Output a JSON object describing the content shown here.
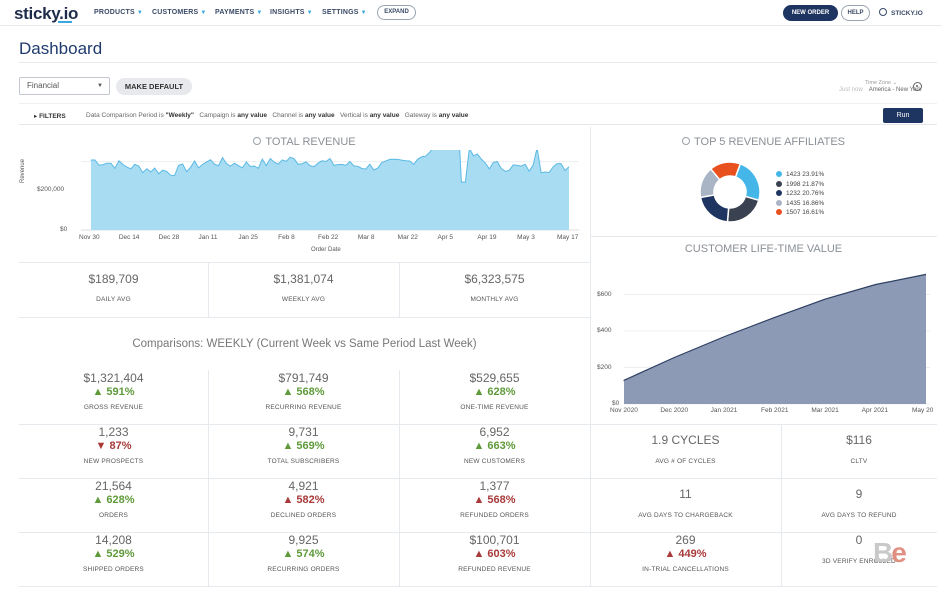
{
  "nav": {
    "logo": "sticky.io",
    "items": [
      {
        "label": "PRODUCTS"
      },
      {
        "label": "CUSTOMERS"
      },
      {
        "label": "PAYMENTS"
      },
      {
        "label": "INSIGHTS"
      },
      {
        "label": "SETTINGS"
      }
    ],
    "expand_label": "EXPAND",
    "new_order_label": "NEW ORDER",
    "help_label": "HELP",
    "user_label": "STICKY.IO"
  },
  "page": {
    "title": "Dashboard",
    "dashboard_select": "Financial",
    "make_default_label": "MAKE DEFAULT",
    "timezone_label": "Time Zone",
    "timezone_updated": "Just now",
    "timezone_value": "America - New York"
  },
  "filters": {
    "toggle_label": "FILTERS",
    "period_label": "Data Comparison Period",
    "period_value": "\"Weekly\"",
    "campaign_label": "Campaign",
    "campaign_value": "any value",
    "channel_label": "Channel",
    "channel_value": "any value",
    "vertical_label": "Vertical",
    "vertical_value": "any value",
    "gateway_label": "Gateway",
    "gateway_value": "any value",
    "is_word": "is",
    "run_label": "Run"
  },
  "revenue": {
    "title": "TOTAL REVENUE",
    "ylabel": "Revenue",
    "xlabel": "Order Date",
    "yticks": [
      "$200,000",
      "$0"
    ],
    "xticks": [
      "Nov 30",
      "Dec 14",
      "Dec 28",
      "Jan 11",
      "Jan 25",
      "Feb 8",
      "Feb 22",
      "Mar 8",
      "Mar 22",
      "Apr 5",
      "Apr 19",
      "May 3",
      "May 17"
    ]
  },
  "affiliates": {
    "title": "TOP 5 REVENUE AFFILIATES",
    "colors": [
      "#45b6e8",
      "#3a4150",
      "#1e3562",
      "#a9b4c5",
      "#e8501e"
    ],
    "legend": [
      "1423 23.91%",
      "1998 21.87%",
      "1232 20.76%",
      "1435 16.86%",
      "1507 16.61%"
    ]
  },
  "clv": {
    "title": "CUSTOMER LIFE-TIME VALUE",
    "yticks": [
      "$600",
      "$400",
      "$200",
      "$0"
    ],
    "xticks": [
      "Nov 2020",
      "Dec 2020",
      "Jan 2021",
      "Feb 2021",
      "Mar 2021",
      "Apr 2021",
      "May 20"
    ]
  },
  "averages": [
    {
      "value": "$189,709",
      "label": "DAILY AVG"
    },
    {
      "value": "$1,381,074",
      "label": "WEEKLY AVG"
    },
    {
      "value": "$6,323,575",
      "label": "MONTHLY AVG"
    }
  ],
  "comparisons": {
    "title": "Comparisons: WEEKLY (Current Week vs Same Period Last Week)",
    "cells": [
      {
        "value": "$1,321,404",
        "delta": "▲ 591%",
        "dir": "up",
        "label": "GROSS REVENUE"
      },
      {
        "value": "$791,749",
        "delta": "▲ 568%",
        "dir": "up",
        "label": "RECURRING REVENUE"
      },
      {
        "value": "$529,655",
        "delta": "▲ 628%",
        "dir": "up",
        "label": "ONE-TIME REVENUE"
      },
      {
        "value": "1,233",
        "delta": "▼ 87%",
        "dir": "down",
        "label": "NEW PROSPECTS"
      },
      {
        "value": "9,731",
        "delta": "▲ 569%",
        "dir": "up",
        "label": "TOTAL SUBSCRIBERS"
      },
      {
        "value": "6,952",
        "delta": "▲ 663%",
        "dir": "up",
        "label": "NEW CUSTOMERS"
      },
      {
        "value": "21,564",
        "delta": "▲ 628%",
        "dir": "up",
        "label": "ORDERS"
      },
      {
        "value": "4,921",
        "delta": "▲ 582%",
        "dir": "down",
        "label": "DECLINED ORDERS"
      },
      {
        "value": "1,377",
        "delta": "▲ 568%",
        "dir": "down",
        "label": "REFUNDED ORDERS"
      },
      {
        "value": "14,208",
        "delta": "▲ 529%",
        "dir": "up",
        "label": "SHIPPED ORDERS"
      },
      {
        "value": "9,925",
        "delta": "▲ 574%",
        "dir": "up",
        "label": "RECURRING ORDERS"
      },
      {
        "value": "$100,701",
        "delta": "▲ 603%",
        "dir": "down",
        "label": "REFUNDED REVENUE"
      }
    ]
  },
  "right_stats": [
    {
      "value": "1.9 CYCLES",
      "delta": "",
      "dir": "",
      "label": "AVG # OF CYCLES"
    },
    {
      "value": "$116",
      "delta": "",
      "dir": "",
      "label": "CLTV"
    },
    {
      "value": "11",
      "delta": "",
      "dir": "",
      "label": "AVG DAYS TO CHARGEBACK"
    },
    {
      "value": "9",
      "delta": "",
      "dir": "",
      "label": "AVG DAYS TO REFUND"
    },
    {
      "value": "269",
      "delta": "▲ 449%",
      "dir": "down",
      "label": "IN-TRIAL CANCELLATIONS"
    },
    {
      "value": "0",
      "delta": "",
      "dir": "",
      "label": "3D VERIFY ENROLLED"
    }
  ],
  "chart_data": [
    {
      "type": "area",
      "title": "TOTAL REVENUE",
      "xlabel": "Order Date",
      "ylabel": "Revenue",
      "ylim": [
        0,
        400000
      ],
      "categories": [
        "Nov 30",
        "Dec 14",
        "Dec 28",
        "Jan 11",
        "Jan 25",
        "Feb 8",
        "Feb 22",
        "Mar 8",
        "Mar 22",
        "Apr 5",
        "Apr 19",
        "May 3",
        "May 17"
      ],
      "values": [
        205000,
        185000,
        170000,
        200000,
        190000,
        205000,
        195000,
        185000,
        200000,
        260000,
        190000,
        180000,
        185000
      ],
      "grid": true
    },
    {
      "type": "pie",
      "title": "TOP 5 REVENUE AFFILIATES",
      "categories": [
        "1423",
        "1998",
        "1232",
        "1435",
        "1507"
      ],
      "values": [
        23.91,
        21.87,
        20.76,
        16.86,
        16.61
      ],
      "legend": "right"
    },
    {
      "type": "area",
      "title": "CUSTOMER LIFE-TIME VALUE",
      "categories": [
        "Nov 2020",
        "Dec 2020",
        "Jan 2021",
        "Feb 2021",
        "Mar 2021",
        "Apr 2021",
        "May 20"
      ],
      "values": [
        130,
        255,
        370,
        475,
        575,
        655,
        710
      ],
      "ylim": [
        0,
        800
      ],
      "grid": true
    }
  ]
}
